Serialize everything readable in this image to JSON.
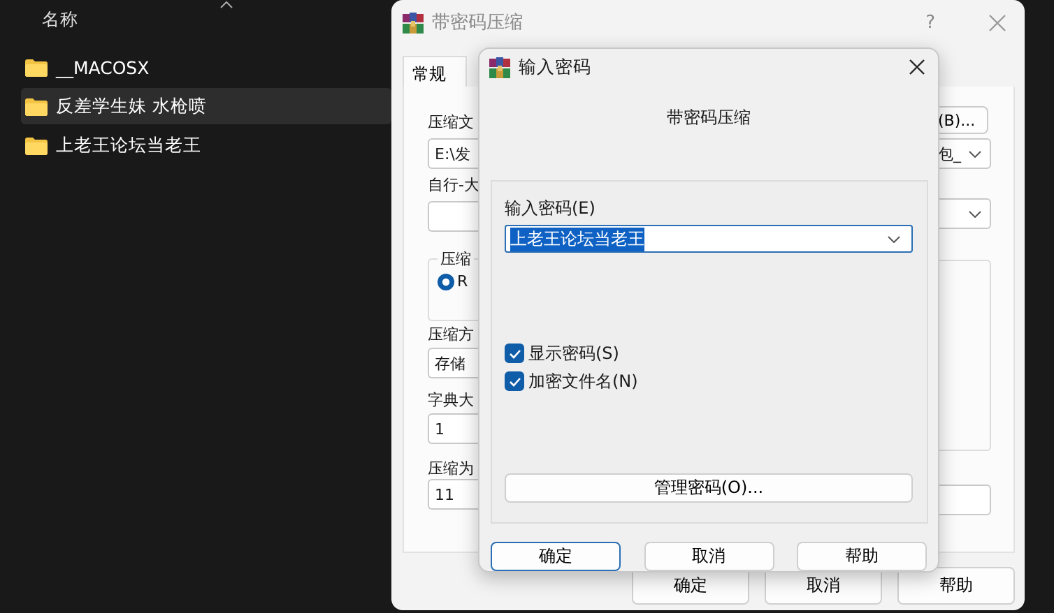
{
  "explorer": {
    "column_header": "名称",
    "items": [
      {
        "name": "__MACOSX",
        "selected": false
      },
      {
        "name": "反差学生妹 水枪喷",
        "selected": true
      },
      {
        "name": "上老王论坛当老王",
        "selected": false
      }
    ]
  },
  "archive_window": {
    "title": "带密码压缩",
    "help": "?",
    "tabs": [
      {
        "label": "常规",
        "selected": true
      }
    ],
    "archive_label": "压缩文",
    "browse_button": "(B)...",
    "archive_path": "E:\\发",
    "update_mode": "包_",
    "profile_label": "自行-大",
    "format_group": {
      "label": "压缩",
      "options": [
        {
          "label": "R",
          "selected": true
        }
      ]
    },
    "method_label": "压缩方",
    "method": "存储",
    "dictionary_label": "字典大",
    "dictionary": "1",
    "volume_label": "压缩为",
    "volume": "11",
    "buttons": [
      "确定",
      "取消",
      "帮助"
    ]
  },
  "password_dialog": {
    "title": "输入密码",
    "heading": "带密码压缩",
    "password_label": "输入密码(E)",
    "password": "上老王论坛当老王",
    "options": [
      {
        "label": "显示密码(S)",
        "checked": true
      },
      {
        "label": "加密文件名(N)",
        "checked": true
      }
    ],
    "manage_button": "管理密码(O)...",
    "buttons": [
      {
        "label": "确定",
        "default": true
      },
      {
        "label": "取消",
        "default": false
      },
      {
        "label": "帮助",
        "default": false
      }
    ]
  }
}
